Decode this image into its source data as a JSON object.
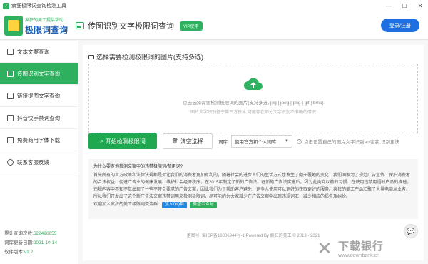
{
  "window": {
    "title": "疯狂极限词查询检测工具",
    "minimize": "—",
    "maximize": "☐",
    "close": "✕"
  },
  "logo": {
    "slogan": "疯狂的美工提供帮助",
    "brand": "极限词查询"
  },
  "header": {
    "title": "传图识别文字极限词查询",
    "vip": "VIP使用",
    "login": "登录/注册"
  },
  "sidebar": {
    "items": [
      {
        "label": "文本文案查询"
      },
      {
        "label": "传图识别文字查询"
      },
      {
        "label": "链接提图文字查询"
      },
      {
        "label": "抖音快手禁词查询"
      },
      {
        "label": "免费商用字体下载"
      },
      {
        "label": "联系客服反馈"
      }
    ],
    "stats": {
      "total_label": "累计查询次数:",
      "total_value": "622496655",
      "update_label": "词库更新日期:",
      "update_value": "2021-10-14",
      "version_label": "软件版本:",
      "version_value": "v1.2"
    }
  },
  "upload": {
    "section_title": "选择需要检测极限词的图片(支持多选)",
    "line1": "点击选择需要检测极限词的图片(支持多选, jpg | jpeg | png | gif | bmp)",
    "line2": "图片文字识别基于第三方技术,可能存在部分文字识别不准确的情况"
  },
  "toolbar": {
    "start": "开始检测极限词",
    "clear": "清空选择",
    "lib_label": "词库:",
    "lib_value": "使用官方和个人词库",
    "hint": "点击设置自己的图片文字识别api密钥,识别更快"
  },
  "faq": {
    "question": "为什么要查询检测文案中的违禁极限词/禁用词?",
    "answer": "首先所有的官方政策和法律法规都是对让我们的消费者更加有利的，随着社会的进步人们的生活方式也发生了翻天覆地的变化，我们国家为了规范广告宣传、保护消费者的合法权益、促进广告业的健康发展、维护社会经济秩序，在2015年制定了新的广告法。在新的广告法实施后，因为此类商以前的习惯、在使用违禁用语时产品的描述，违规内容中不知不觉出现了一些不符合要求的广告文案，因此我们为了帮助客户避免，更多人使用可以更好的获取更好的服务。疯狂的美工产品汇聚了大量电商从业者、所以我们开发出了这个新广告法文案违禁词用来检测极限词，尽可能的为大家减少在广告文案中出现违规词汇，减少相应的损失及纠纷。",
    "join_text": "欢迎加入疯狂的美工极限词交流群:",
    "qq": "加入QQ群",
    "wechat": "微信公众号"
  },
  "footer": {
    "text": "备案号: 蜀ICP备18006944号-1 Powered By 疯狂的美工 © 2013 - 2021"
  },
  "watermark": {
    "zh": "下载银行",
    "en": "www.downbank.cn"
  },
  "colors": {
    "accent": "#2fb05e",
    "primary_blue": "#1f6fe0",
    "start_button": "#1fa84f"
  }
}
